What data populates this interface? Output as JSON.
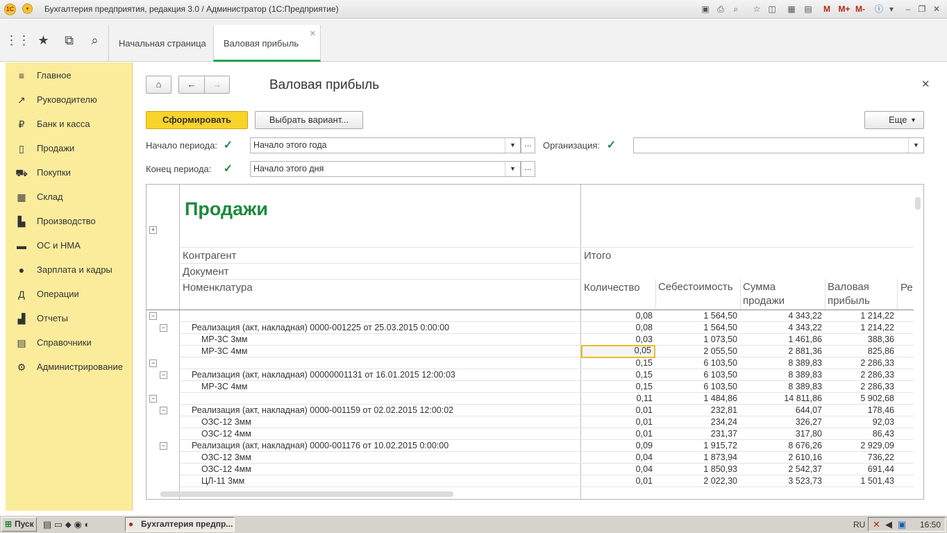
{
  "window": {
    "title": "Бухгалтерия предприятия, редакция 3.0 / Администратор  (1С:Предприятие)",
    "logo_text": "1С"
  },
  "title_toolbar": [
    "M",
    "M+",
    "M-"
  ],
  "tabs": [
    {
      "label": "Начальная страница"
    },
    {
      "label": "Валовая прибыль"
    }
  ],
  "sidebar": {
    "items": [
      {
        "label": "Главное",
        "icon": "menu-icon"
      },
      {
        "label": "Руководителю",
        "icon": "chart-line-icon"
      },
      {
        "label": "Банк и касса",
        "icon": "ruble-icon"
      },
      {
        "label": "Продажи",
        "icon": "sales-icon"
      },
      {
        "label": "Покупки",
        "icon": "cart-icon"
      },
      {
        "label": "Склад",
        "icon": "warehouse-icon"
      },
      {
        "label": "Производство",
        "icon": "factory-icon"
      },
      {
        "label": "ОС и НМА",
        "icon": "truck-icon"
      },
      {
        "label": "Зарплата и кадры",
        "icon": "person-icon"
      },
      {
        "label": "Операции",
        "icon": "operations-icon"
      },
      {
        "label": "Отчеты",
        "icon": "bar-chart-icon"
      },
      {
        "label": "Справочники",
        "icon": "book-icon"
      },
      {
        "label": "Администрирование",
        "icon": "gear-icon"
      }
    ]
  },
  "form": {
    "title": "Валовая прибыль",
    "generate_label": "Сформировать",
    "variant_label": "Выбрать вариант...",
    "more_label": "Еще",
    "period_start_label": "Начало периода:",
    "period_start_value": "Начало этого года",
    "period_end_label": "Конец периода:",
    "period_end_value": "Начало этого дня",
    "org_label": "Организация:",
    "org_value": "",
    "ellipsis": "..."
  },
  "report": {
    "title": "Продажи",
    "group1": "Контрагент",
    "group2": "Документ",
    "group3": "Номенклатура",
    "total_header": "Итого",
    "columns": [
      "Количество",
      "Себестоимость",
      "Сумма продажи",
      "Валовая прибыль",
      "Ре"
    ],
    "rows": [
      {
        "level": 0,
        "name": "",
        "qty": "0,08",
        "cost": "1 564,50",
        "sum": "4 343,22",
        "profit": "1 214,22"
      },
      {
        "level": 1,
        "name": "Реализация (акт, накладная) 0000-001225 от 25.03.2015 0:00:00",
        "qty": "0,08",
        "cost": "1 564,50",
        "sum": "4 343,22",
        "profit": "1 214,22"
      },
      {
        "level": 2,
        "name": "МР-3С 3мм",
        "qty": "0,03",
        "cost": "1 073,50",
        "sum": "1 461,86",
        "profit": "388,36"
      },
      {
        "level": 2,
        "name": "МР-3С 4мм",
        "qty": "0,05",
        "cost": "2 055,50",
        "sum": "2 881,36",
        "profit": "825,86",
        "selected": true
      },
      {
        "level": 0,
        "name": "",
        "qty": "0,15",
        "cost": "6 103,50",
        "sum": "8 389,83",
        "profit": "2 286,33"
      },
      {
        "level": 1,
        "name": "Реализация (акт, накладная) 00000001131 от 16.01.2015 12:00:03",
        "qty": "0,15",
        "cost": "6 103,50",
        "sum": "8 389,83",
        "profit": "2 286,33"
      },
      {
        "level": 2,
        "name": "МР-3С 4мм",
        "qty": "0,15",
        "cost": "6 103,50",
        "sum": "8 389,83",
        "profit": "2 286,33"
      },
      {
        "level": 0,
        "name": "",
        "qty": "0,11",
        "cost": "1 484,86",
        "sum": "14 811,86",
        "profit": "5 902,68"
      },
      {
        "level": 1,
        "name": "Реализация (акт, накладная) 0000-001159 от 02.02.2015 12:00:02",
        "qty": "0,01",
        "cost": "232,81",
        "sum": "644,07",
        "profit": "178,46"
      },
      {
        "level": 2,
        "name": "ОЗС-12 3мм",
        "qty": "0,01",
        "cost": "234,24",
        "sum": "326,27",
        "profit": "92,03"
      },
      {
        "level": 2,
        "name": "ОЗС-12 4мм",
        "qty": "0,01",
        "cost": "231,37",
        "sum": "317,80",
        "profit": "86,43"
      },
      {
        "level": 1,
        "name": "Реализация (акт, накладная) 0000-001176 от 10.02.2015 0:00:00",
        "qty": "0,09",
        "cost": "1 915,72",
        "sum": "8 676,26",
        "profit": "2 929,09"
      },
      {
        "level": 2,
        "name": "ОЗС-12 3мм",
        "qty": "0,04",
        "cost": "1 873,94",
        "sum": "2 610,16",
        "profit": "736,22"
      },
      {
        "level": 2,
        "name": "ОЗС-12 4мм",
        "qty": "0,04",
        "cost": "1 850,93",
        "sum": "2 542,37",
        "profit": "691,44"
      },
      {
        "level": 2,
        "name": "ЦЛ-11 3мм",
        "qty": "0,01",
        "cost": "2 022,30",
        "sum": "3 523,73",
        "profit": "1 501,43"
      }
    ]
  },
  "taskbar": {
    "start_label": "Пуск",
    "task_label": "Бухгалтерия предпр...",
    "lang": "RU",
    "time": "16:50"
  }
}
